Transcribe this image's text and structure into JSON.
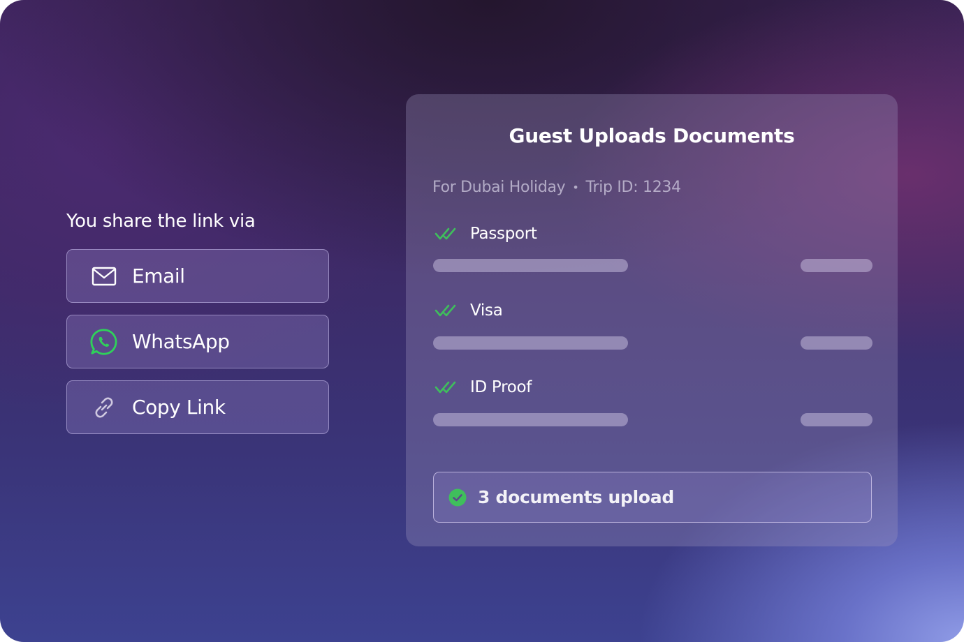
{
  "share": {
    "title": "You share the link via",
    "options": [
      {
        "label": "Email",
        "icon": "mail-icon"
      },
      {
        "label": "WhatsApp",
        "icon": "whatsapp-icon"
      },
      {
        "label": "Copy Link",
        "icon": "link-icon"
      }
    ]
  },
  "card": {
    "title": "Guest Uploads Documents",
    "trip_name": "For Dubai Holiday",
    "separator": "•",
    "trip_id": "Trip ID: 1234",
    "documents": [
      {
        "label": "Passport",
        "icon": "double-check-icon"
      },
      {
        "label": "Visa",
        "icon": "double-check-icon"
      },
      {
        "label": "ID Proof",
        "icon": "double-check-icon"
      }
    ],
    "status_text": "3 documents upload",
    "status_icon": "check-circle-icon"
  },
  "colors": {
    "accent_green": "#3fbf5c",
    "whatsapp_green": "#2fd15a"
  }
}
